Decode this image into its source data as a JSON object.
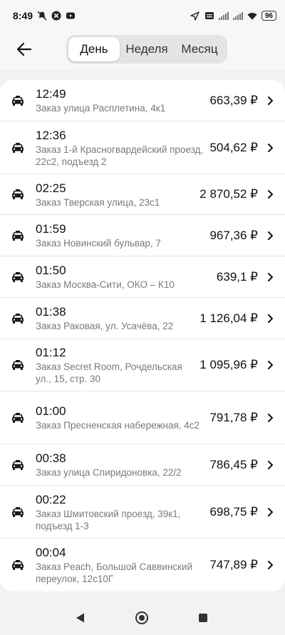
{
  "status_bar": {
    "time": "8:49",
    "battery": "96",
    "icons": [
      "notification-off-icon",
      "app-x-icon",
      "youtube-icon",
      "location-arrow-icon",
      "volte-icon",
      "signal-icon",
      "signal-icon",
      "wifi-icon"
    ]
  },
  "header": {
    "back_icon": "arrow-left-icon",
    "tabs": [
      {
        "label": "День",
        "active": true
      },
      {
        "label": "Неделя",
        "active": false
      },
      {
        "label": "Месяц",
        "active": false
      }
    ]
  },
  "orders": [
    {
      "time": "12:49",
      "address": "Заказ улица Расплетина, 4к1",
      "amount": "663,39 ₽"
    },
    {
      "time": "12:36",
      "address": "Заказ 1-й Красногвардейский проезд, 22с2, подъезд 2",
      "amount": "504,62 ₽"
    },
    {
      "time": "02:25",
      "address": "Заказ Тверская улица, 23с1",
      "amount": "2 870,52 ₽"
    },
    {
      "time": "01:59",
      "address": "Заказ Новинский бульвар, 7",
      "amount": "967,36 ₽"
    },
    {
      "time": "01:50",
      "address": "Заказ Москва-Сити, ОКО – К10",
      "amount": "639,1 ₽"
    },
    {
      "time": "01:38",
      "address": "Заказ Раковая, ул. Усачёва, 22",
      "amount": "1 126,04 ₽"
    },
    {
      "time": "01:12",
      "address": "Заказ Secret Room, Рочдельская ул., 15, стр. 30",
      "amount": "1 095,96 ₽"
    },
    {
      "time": "01:00",
      "address": "Заказ Пресненская набережная, 4с2",
      "amount": "791,78 ₽"
    },
    {
      "time": "00:38",
      "address": "Заказ улица Спиридоновка, 22/2",
      "amount": "786,45 ₽"
    },
    {
      "time": "00:22",
      "address": "Заказ Шмитовский проезд, 39к1, подъезд 1-3",
      "amount": "698,75 ₽"
    },
    {
      "time": "00:04",
      "address": "Заказ Peach, Большой Саввинский переулок, 12с10Г",
      "amount": "747,89 ₽"
    }
  ],
  "row_icon": "taxi-car-icon",
  "nav": {
    "icons": [
      "back-triangle-icon",
      "home-circle-icon",
      "recents-square-icon"
    ]
  }
}
